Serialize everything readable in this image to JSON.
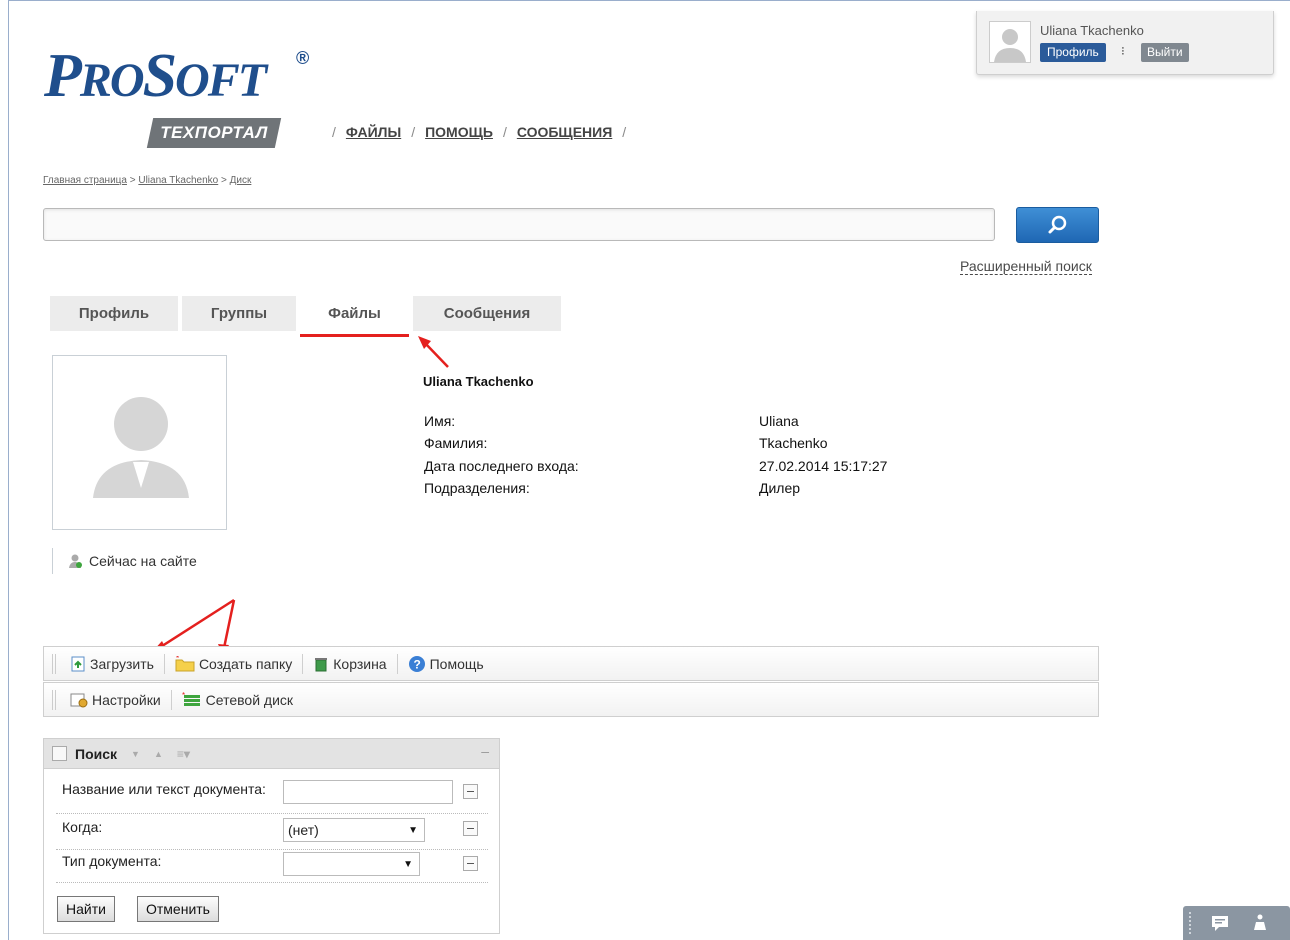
{
  "logo": {
    "word_a": "P",
    "word_b": "RO",
    "word_c": "S",
    "word_d": "OFT",
    "reg": "®",
    "badge": "ТЕХПОРТАЛ"
  },
  "topnav": {
    "items": [
      "ФАЙЛЫ",
      "ПОМОЩЬ",
      "СООБЩЕНИЯ"
    ],
    "sep": "/"
  },
  "user": {
    "name": "Uliana Tkachenko",
    "profile_btn": "Профиль",
    "dots": "⁝",
    "exit_btn": "Выйти"
  },
  "breadcrumb": {
    "items": [
      "Главная страница",
      "Uliana Tkachenko",
      "Диск"
    ],
    "sep": ">"
  },
  "search": {
    "value": "",
    "advanced": "Расширенный поиск"
  },
  "tabs": [
    "Профиль",
    "Группы",
    "Файлы",
    "Сообщения"
  ],
  "active_tab": "Файлы",
  "profile": {
    "name": "Uliana Tkachenko",
    "fields": [
      {
        "label": "Имя:",
        "value": "Uliana"
      },
      {
        "label": "Фамилия:",
        "value": "Tkachenko"
      },
      {
        "label": "Дата последнего входа:",
        "value": "27.02.2014 15:17:27"
      },
      {
        "label": "Подразделения:",
        "value": "Дилер"
      }
    ],
    "status": "Сейчас на сайте"
  },
  "toolbar1": {
    "upload": "Загрузить",
    "create_folder": "Создать папку",
    "trash": "Корзина",
    "help": "Помощь"
  },
  "toolbar2": {
    "settings": "Настройки",
    "network_disk": "Сетевой диск"
  },
  "search_panel": {
    "title": "Поиск",
    "rows": [
      {
        "label": "Название или текст документа:",
        "value": ""
      },
      {
        "label": "Когда:",
        "value": "(нет)"
      },
      {
        "label": "Тип документа:",
        "value": ""
      }
    ],
    "find_btn": "Найти",
    "cancel_btn": "Отменить",
    "minimize": "–"
  },
  "colors": {
    "brand_blue": "#1f4e8c",
    "accent_red": "#e4201e",
    "button_blue": "#2b5b9a"
  }
}
